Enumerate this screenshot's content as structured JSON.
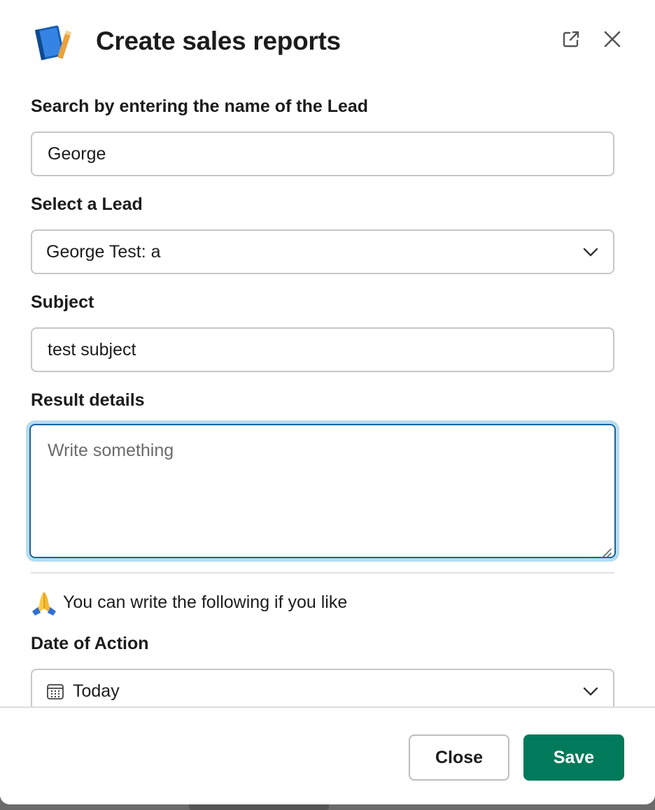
{
  "modal": {
    "title": "Create sales reports",
    "app_icon": "blue-book-icon",
    "header_buttons": [
      "external-link-icon",
      "close-icon"
    ]
  },
  "form": {
    "search": {
      "label": "Search by entering the name of the Lead",
      "value": "George"
    },
    "lead": {
      "label": "Select a Lead",
      "selected": "George Test: a"
    },
    "subject": {
      "label": "Subject",
      "value": "test subject"
    },
    "result_details": {
      "label": "Result details",
      "placeholder": "Write something"
    },
    "hint": {
      "icon": "folded-hands-icon",
      "text": "You can write the following if you like"
    },
    "date_of_action": {
      "label": "Date of Action",
      "selected": "Today",
      "icon": "calendar-icon"
    }
  },
  "footer": {
    "close_label": "Close",
    "save_label": "Save"
  },
  "colors": {
    "accent": "#1264a3",
    "focus_ring": "#b8dcef",
    "save_button": "#007a5a",
    "text": "#1d1c1d",
    "border": "#c7c7c7"
  }
}
